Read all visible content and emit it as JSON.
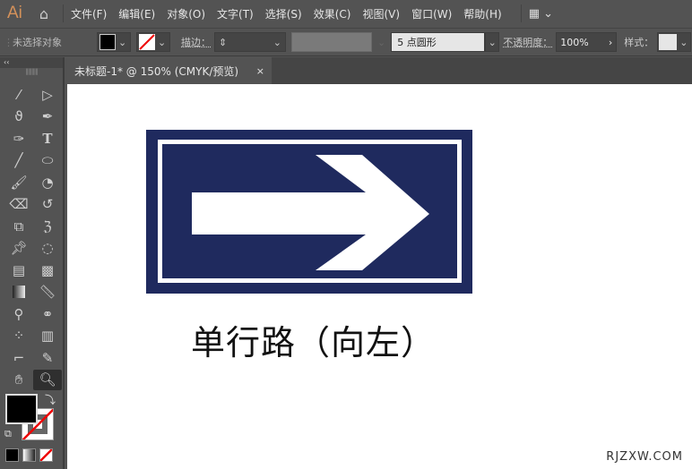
{
  "app": {
    "logo": "Ai"
  },
  "menu": [
    "文件(F)",
    "编辑(E)",
    "对象(O)",
    "文字(T)",
    "选择(S)",
    "效果(C)",
    "视图(V)",
    "窗口(W)",
    "帮助(H)"
  ],
  "control": {
    "selection": "未选择对象",
    "stroke_label": "描边：",
    "brush": "5 点圆形",
    "opacity_label": "不透明度：",
    "opacity": "100%",
    "style_label": "样式："
  },
  "tab": {
    "title": "未标题-1* @ 150% (CMYK/预览)",
    "close": "×"
  },
  "tools": [
    "magic-wand",
    "direct-selection",
    "lasso",
    "pen",
    "curvature",
    "type",
    "line",
    "ellipse",
    "paintbrush",
    "shaper",
    "eraser",
    "rotate",
    "scale",
    "warp",
    "pin",
    "perspective-select",
    "perspective-grid",
    "mesh",
    "gradient",
    "measure",
    "eyedropper",
    "blend",
    "symbol-sprayer",
    "graph",
    "artboard",
    "slice",
    "hand",
    "zoom"
  ],
  "artwork": {
    "caption": "单行路（向左）",
    "sign_color": "#1f2a5e"
  },
  "watermark": "RJZXW.COM"
}
